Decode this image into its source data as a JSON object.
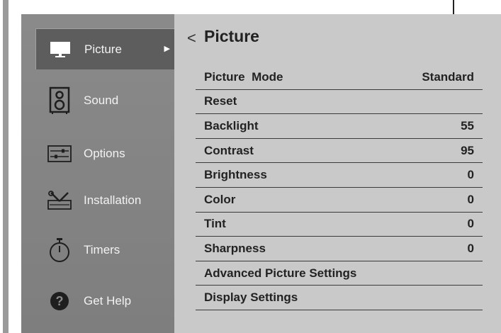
{
  "sidebar": {
    "items": [
      {
        "label": "Picture",
        "icon": "tv-icon",
        "active": true
      },
      {
        "label": "Sound",
        "icon": "speaker-icon",
        "active": false
      },
      {
        "label": "Options",
        "icon": "sliders-icon",
        "active": false
      },
      {
        "label": "Installation",
        "icon": "tools-icon",
        "active": false
      },
      {
        "label": "Timers",
        "icon": "stopwatch-icon",
        "active": false
      },
      {
        "label": "Get Help",
        "icon": "help-icon",
        "active": false
      }
    ]
  },
  "content": {
    "back": "<",
    "title": "Picture",
    "rows": [
      {
        "label": "Picture  Mode",
        "value": "Standard"
      },
      {
        "label": "Reset",
        "value": ""
      },
      {
        "label": "Backlight",
        "value": "55"
      },
      {
        "label": "Contrast",
        "value": "95"
      },
      {
        "label": "Brightness",
        "value": "0"
      },
      {
        "label": "Color",
        "value": "0"
      },
      {
        "label": "Tint",
        "value": "0"
      },
      {
        "label": "Sharpness",
        "value": "0"
      },
      {
        "label": "Advanced Picture Settings",
        "value": ""
      },
      {
        "label": "Display Settings",
        "value": ""
      }
    ]
  },
  "colors": {
    "screen_bg": "#c9c9c9",
    "sidebar_bg": "#858585",
    "active_item_bg": "#5d5d5d",
    "text_dark": "#222222",
    "text_light": "#f2f2f2"
  }
}
